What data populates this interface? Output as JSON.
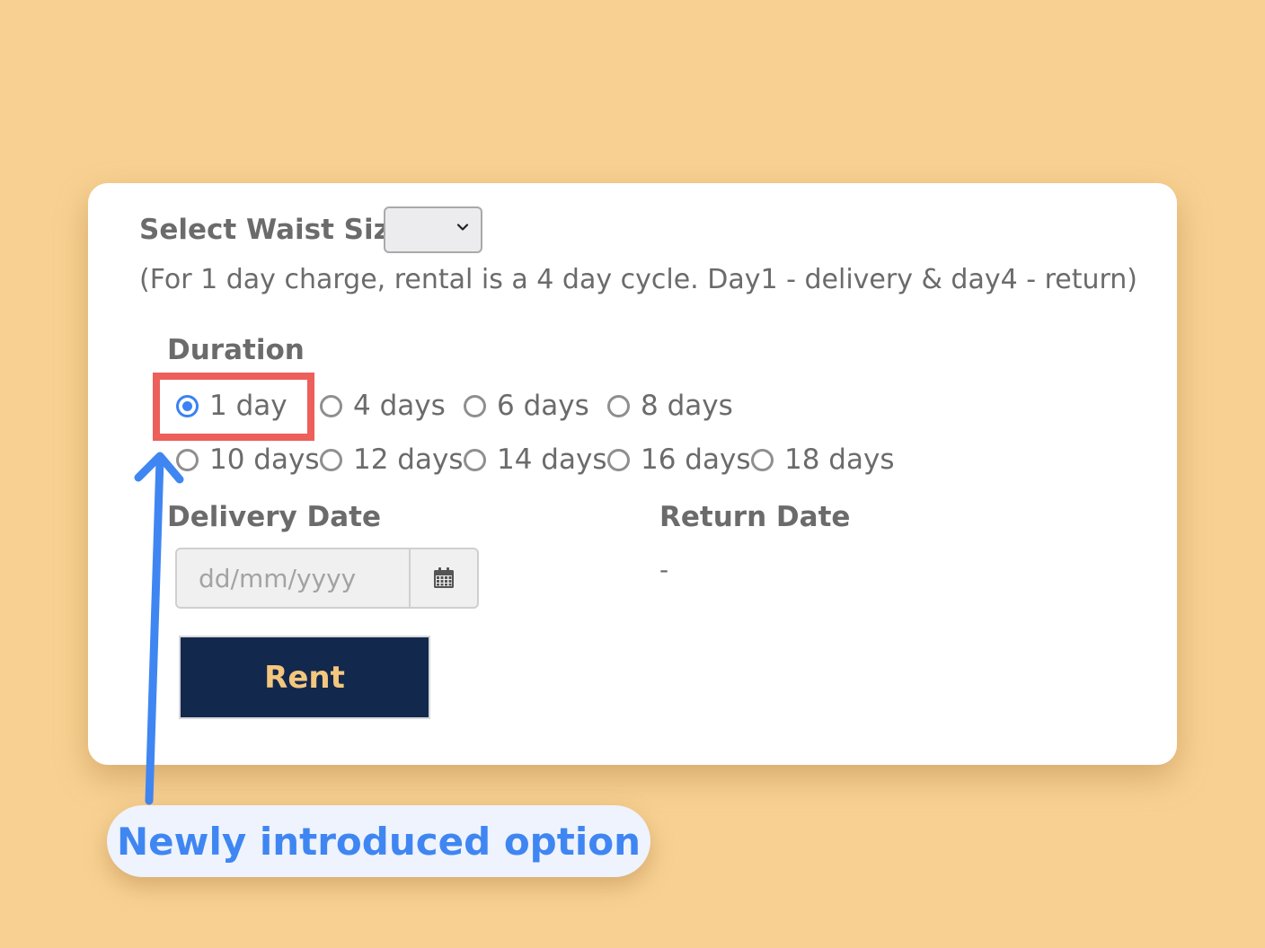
{
  "form": {
    "waist_label": "Select Waist Size",
    "waist_value": "",
    "note": "(For 1 day charge, rental is a 4 day cycle. Day1 - delivery & day4 - return)",
    "duration_label": "Duration",
    "durations": [
      {
        "label": "1 day",
        "checked": true
      },
      {
        "label": "4 days",
        "checked": false
      },
      {
        "label": "6 days",
        "checked": false
      },
      {
        "label": "8 days",
        "checked": false
      },
      {
        "label": "10 days",
        "checked": false
      },
      {
        "label": "12 days",
        "checked": false
      },
      {
        "label": "14 days",
        "checked": false
      },
      {
        "label": "16 days",
        "checked": false
      },
      {
        "label": "18 days",
        "checked": false
      }
    ],
    "delivery_label": "Delivery Date",
    "delivery_placeholder": "dd/mm/yyyy",
    "return_label": "Return Date",
    "return_value": "-",
    "rent_label": "Rent"
  },
  "annotation": {
    "callout_text": "Newly introduced option",
    "highlight_color": "#ec5f5b",
    "arrow_color": "#3f86f2"
  },
  "colors": {
    "background": "#f8d192",
    "button_bg": "#13284d",
    "button_text": "#f4c77e",
    "radio_accent": "#3a82f6"
  }
}
